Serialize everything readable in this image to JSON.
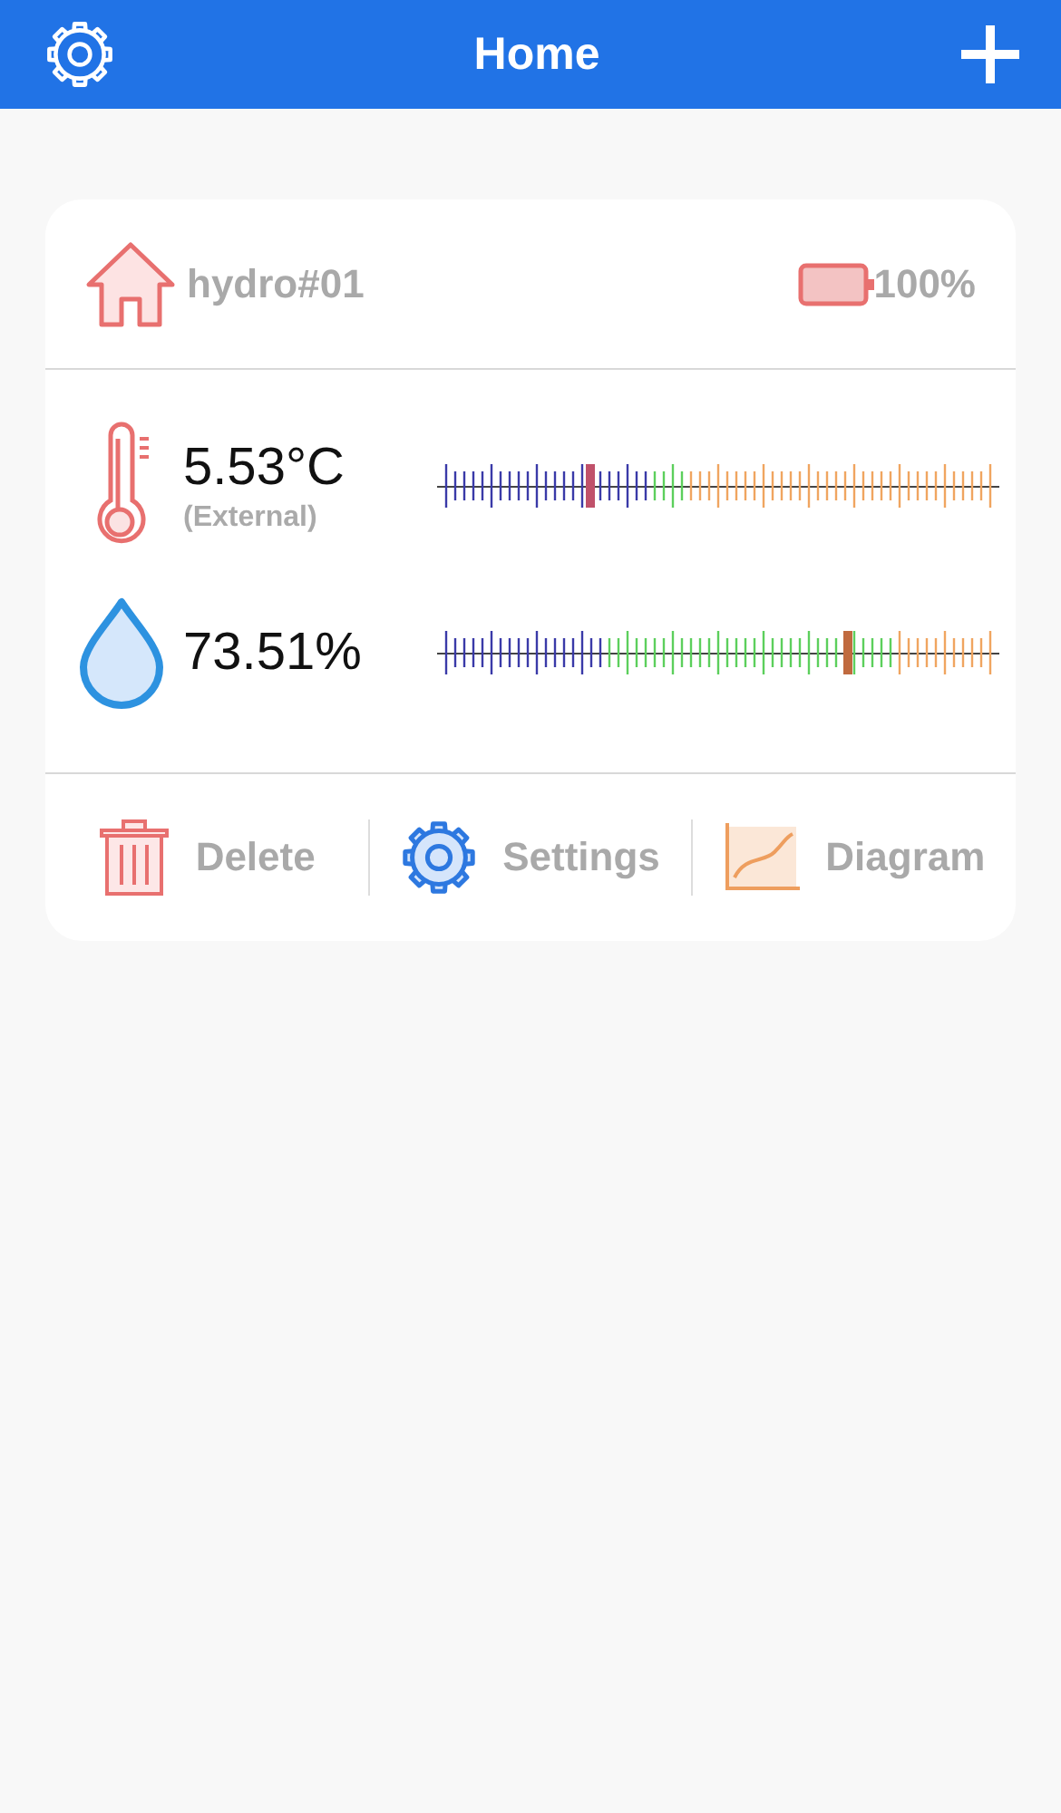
{
  "header": {
    "title": "Home"
  },
  "device": {
    "name": "hydro#01",
    "battery": "100%"
  },
  "readings": [
    {
      "kind": "temperature",
      "value": "5.53°C",
      "note": "(External)",
      "level": 0.27
    },
    {
      "kind": "humidity",
      "value": "73.51%",
      "level": 0.73
    }
  ],
  "actions": [
    {
      "kind": "delete",
      "label": "Delete"
    },
    {
      "kind": "settings",
      "label": "Settings"
    },
    {
      "kind": "diagram",
      "label": "Diagram"
    }
  ]
}
